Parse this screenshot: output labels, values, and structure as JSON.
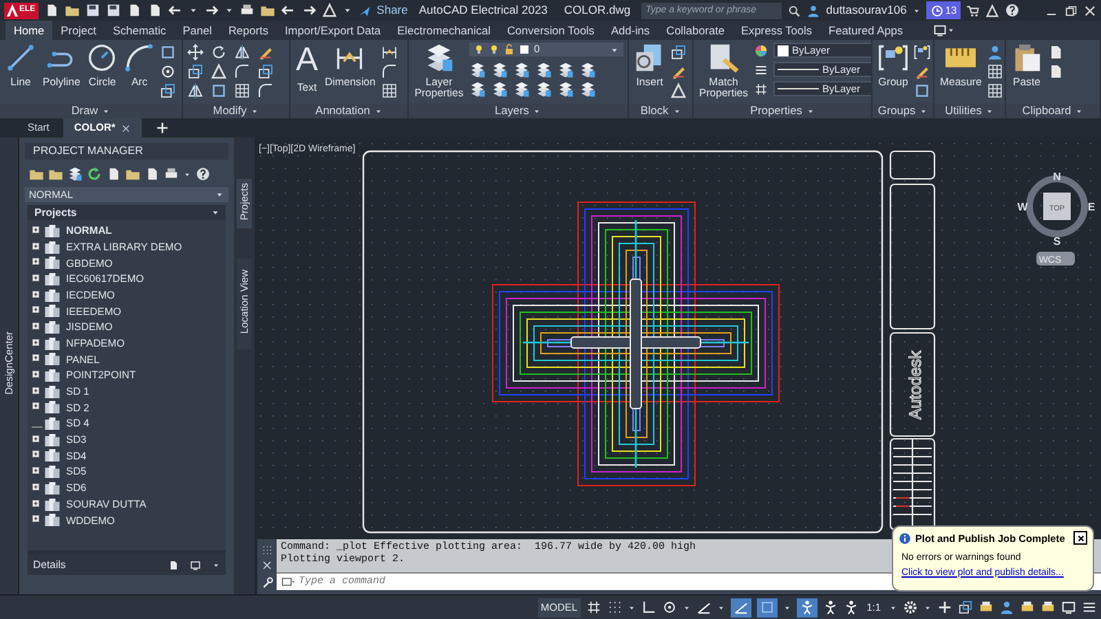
{
  "title_bar": {
    "badge": "ELE",
    "share": "Share",
    "app_title": "AutoCAD Electrical 2023",
    "file_name": "COLOR.dwg",
    "search_placeholder": "Type a keyword or phrase",
    "user": "duttasourav106",
    "notification_count": "13"
  },
  "ribbon_tabs": [
    {
      "label": "Home",
      "selected": true
    },
    {
      "label": "Project",
      "selected": false
    },
    {
      "label": "Schematic",
      "selected": false
    },
    {
      "label": "Panel",
      "selected": false
    },
    {
      "label": "Reports",
      "selected": false
    },
    {
      "label": "Import/Export Data",
      "selected": false
    },
    {
      "label": "Electromechanical",
      "selected": false
    },
    {
      "label": "Conversion Tools",
      "selected": false
    },
    {
      "label": "Add-ins",
      "selected": false
    },
    {
      "label": "Collaborate",
      "selected": false
    },
    {
      "label": "Express Tools",
      "selected": false
    },
    {
      "label": "Featured Apps",
      "selected": false
    }
  ],
  "ribbon_panels": [
    {
      "kind": "draw",
      "title": "Draw",
      "tools": [
        {
          "label": "Line"
        },
        {
          "label": "Polyline"
        },
        {
          "label": "Circle"
        },
        {
          "label": "Arc"
        }
      ]
    },
    {
      "kind": "modify",
      "title": "Modify"
    },
    {
      "kind": "annotation",
      "title": "Annotation",
      "tools": [
        {
          "label": "Text",
          "glyph": "A"
        },
        {
          "label": "Dimension"
        }
      ]
    },
    {
      "kind": "layers",
      "title": "Layers",
      "tools": [
        {
          "label": "Layer Properties"
        }
      ],
      "dropdowns": [
        "0"
      ]
    },
    {
      "kind": "block",
      "title": "Block",
      "tools": [
        {
          "label": "Insert"
        }
      ]
    },
    {
      "kind": "properties",
      "title": "Properties",
      "tools": [
        {
          "label": "Match Properties"
        }
      ],
      "dropdowns": [
        "ByLayer",
        "ByLayer",
        "ByLayer"
      ]
    },
    {
      "kind": "groups",
      "title": "Groups",
      "tools": [
        {
          "label": "Group"
        }
      ]
    },
    {
      "kind": "utilities",
      "title": "Utilities",
      "tools": [
        {
          "label": "Measure"
        }
      ]
    },
    {
      "kind": "clipboard",
      "title": "Clipboard",
      "tools": [
        {
          "label": "Paste"
        }
      ]
    }
  ],
  "file_tabs": [
    {
      "label": "Start",
      "selected": false
    },
    {
      "label": "COLOR*",
      "selected": true
    }
  ],
  "design_center": "DesignCenter",
  "project_manager": {
    "title": "PROJECT MANAGER",
    "dropdown": "NORMAL",
    "section": "Projects",
    "footer": "Details",
    "projects": [
      {
        "label": "NORMAL",
        "active": true,
        "expandable": true
      },
      {
        "label": "EXTRA LIBRARY DEMO",
        "active": false,
        "expandable": true
      },
      {
        "label": "GBDEMO",
        "active": false,
        "expandable": true
      },
      {
        "label": "IEC60617DEMO",
        "active": false,
        "expandable": true
      },
      {
        "label": "IECDEMO",
        "active": false,
        "expandable": true
      },
      {
        "label": "IEEEDEMO",
        "active": false,
        "expandable": true
      },
      {
        "label": "JISDEMO",
        "active": false,
        "expandable": true
      },
      {
        "label": "NFPADEMO",
        "active": false,
        "expandable": true
      },
      {
        "label": "PANEL",
        "active": false,
        "expandable": true
      },
      {
        "label": "POINT2POINT",
        "active": false,
        "expandable": true
      },
      {
        "label": "SD 1",
        "active": false,
        "expandable": true
      },
      {
        "label": "SD 2",
        "active": false,
        "expandable": true
      },
      {
        "label": "SD 4",
        "active": false,
        "expandable": false
      },
      {
        "label": "SD3",
        "active": false,
        "expandable": true
      },
      {
        "label": "SD4",
        "active": false,
        "expandable": true
      },
      {
        "label": "SD5",
        "active": false,
        "expandable": true
      },
      {
        "label": "SD6",
        "active": false,
        "expandable": true
      },
      {
        "label": "SOURAV DUTTA",
        "active": false,
        "expandable": true
      },
      {
        "label": "WDDEMO",
        "active": false,
        "expandable": true
      }
    ]
  },
  "side_tabs": [
    {
      "label": "Projects",
      "selected": true
    },
    {
      "label": "Location View",
      "selected": false
    }
  ],
  "viewport": {
    "label": "[−][Top][2D Wireframe]",
    "title_block_text": "Autodesk",
    "compass": {
      "north": "N",
      "south": "S",
      "east": "E",
      "west": "W",
      "face": "TOP",
      "ucs": "WCS"
    }
  },
  "command_window": {
    "history": [
      "Command: _plot Effective plotting area:  196.77 wide by 420.00 high",
      "Plotting viewport 2."
    ],
    "placeholder": "Type a command"
  },
  "status_bar": {
    "model": "MODEL",
    "scale": "1:1"
  },
  "notification": {
    "title": "Plot and Publish Job Complete",
    "message": "No errors or warnings found",
    "link": "Click to view plot and publish details..."
  }
}
